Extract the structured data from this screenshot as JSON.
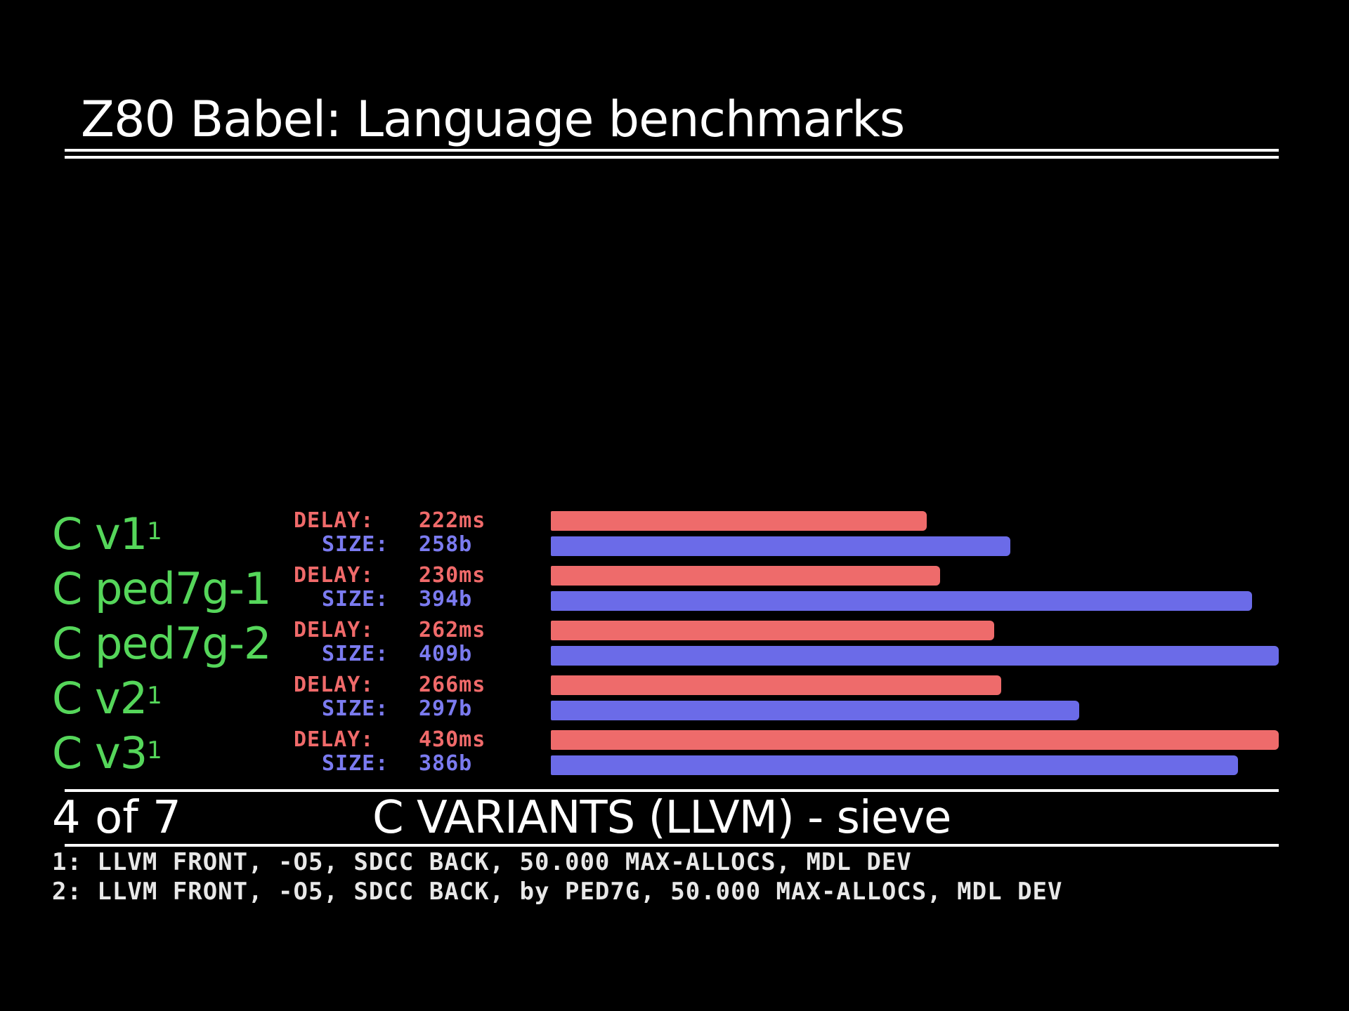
{
  "title": "Z80 Babel: Language benchmarks",
  "footer": {
    "page": "4 of 7",
    "title": "C VARIANTS (LLVM) - sieve"
  },
  "notes": [
    "1: LLVM FRONT, -O5, SDCC BACK, 50.000 MAX-ALLOCS, MDL DEV",
    "2: LLVM FRONT, -O5, SDCC BACK, by PED7G, 50.000 MAX-ALLOCS, MDL DEV"
  ],
  "colors": {
    "label": "#55d65a",
    "delay": "#ee6b6b",
    "size": "#6b6be8",
    "background": "#000000"
  },
  "metric_labels": {
    "delay": "DELAY:",
    "size": "SIZE:"
  },
  "rows": [
    {
      "name": "C v1",
      "sup": "1",
      "delay_text": "222ms",
      "size_text": "258b"
    },
    {
      "name": "C ped7g-1",
      "sup": "",
      "delay_text": "230ms",
      "size_text": "394b"
    },
    {
      "name": "C ped7g-2",
      "sup": "",
      "delay_text": "262ms",
      "size_text": "409b"
    },
    {
      "name": "C v2",
      "sup": "1",
      "delay_text": "266ms",
      "size_text": "297b"
    },
    {
      "name": "C v3",
      "sup": "1",
      "delay_text": "430ms",
      "size_text": "386b"
    }
  ],
  "chart_data": {
    "type": "bar",
    "title": "C VARIANTS (LLVM) - sieve",
    "categories": [
      "C v1",
      "C ped7g-1",
      "C ped7g-2",
      "C v2",
      "C v3"
    ],
    "series": [
      {
        "name": "DELAY",
        "unit": "ms",
        "values": [
          222,
          230,
          262,
          266,
          430
        ]
      },
      {
        "name": "SIZE",
        "unit": "b",
        "values": [
          258,
          394,
          409,
          297,
          386
        ]
      }
    ]
  }
}
